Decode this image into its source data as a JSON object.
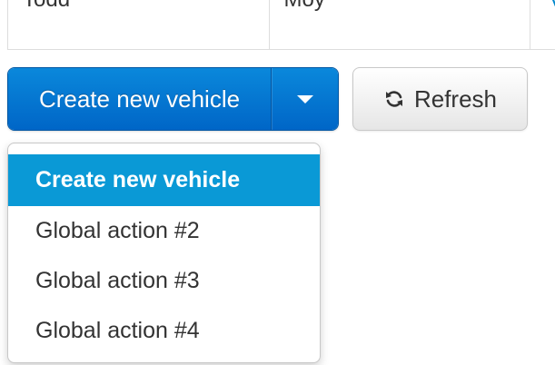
{
  "table": {
    "row": {
      "cells": [
        "Todd",
        "Moy",
        "V"
      ]
    }
  },
  "toolbar": {
    "create_label": "Create new vehicle",
    "refresh_label": "Refresh"
  },
  "dropdown": {
    "items": [
      {
        "label": "Create new vehicle"
      },
      {
        "label": "Global action #2"
      },
      {
        "label": "Global action #3"
      },
      {
        "label": "Global action #4"
      }
    ]
  },
  "colors": {
    "primary": "#0066c7",
    "menu_highlight": "#0a99d6",
    "link": "#0088cc"
  },
  "icons": {
    "caret": "chevron-down-icon",
    "refresh": "refresh-icon"
  }
}
